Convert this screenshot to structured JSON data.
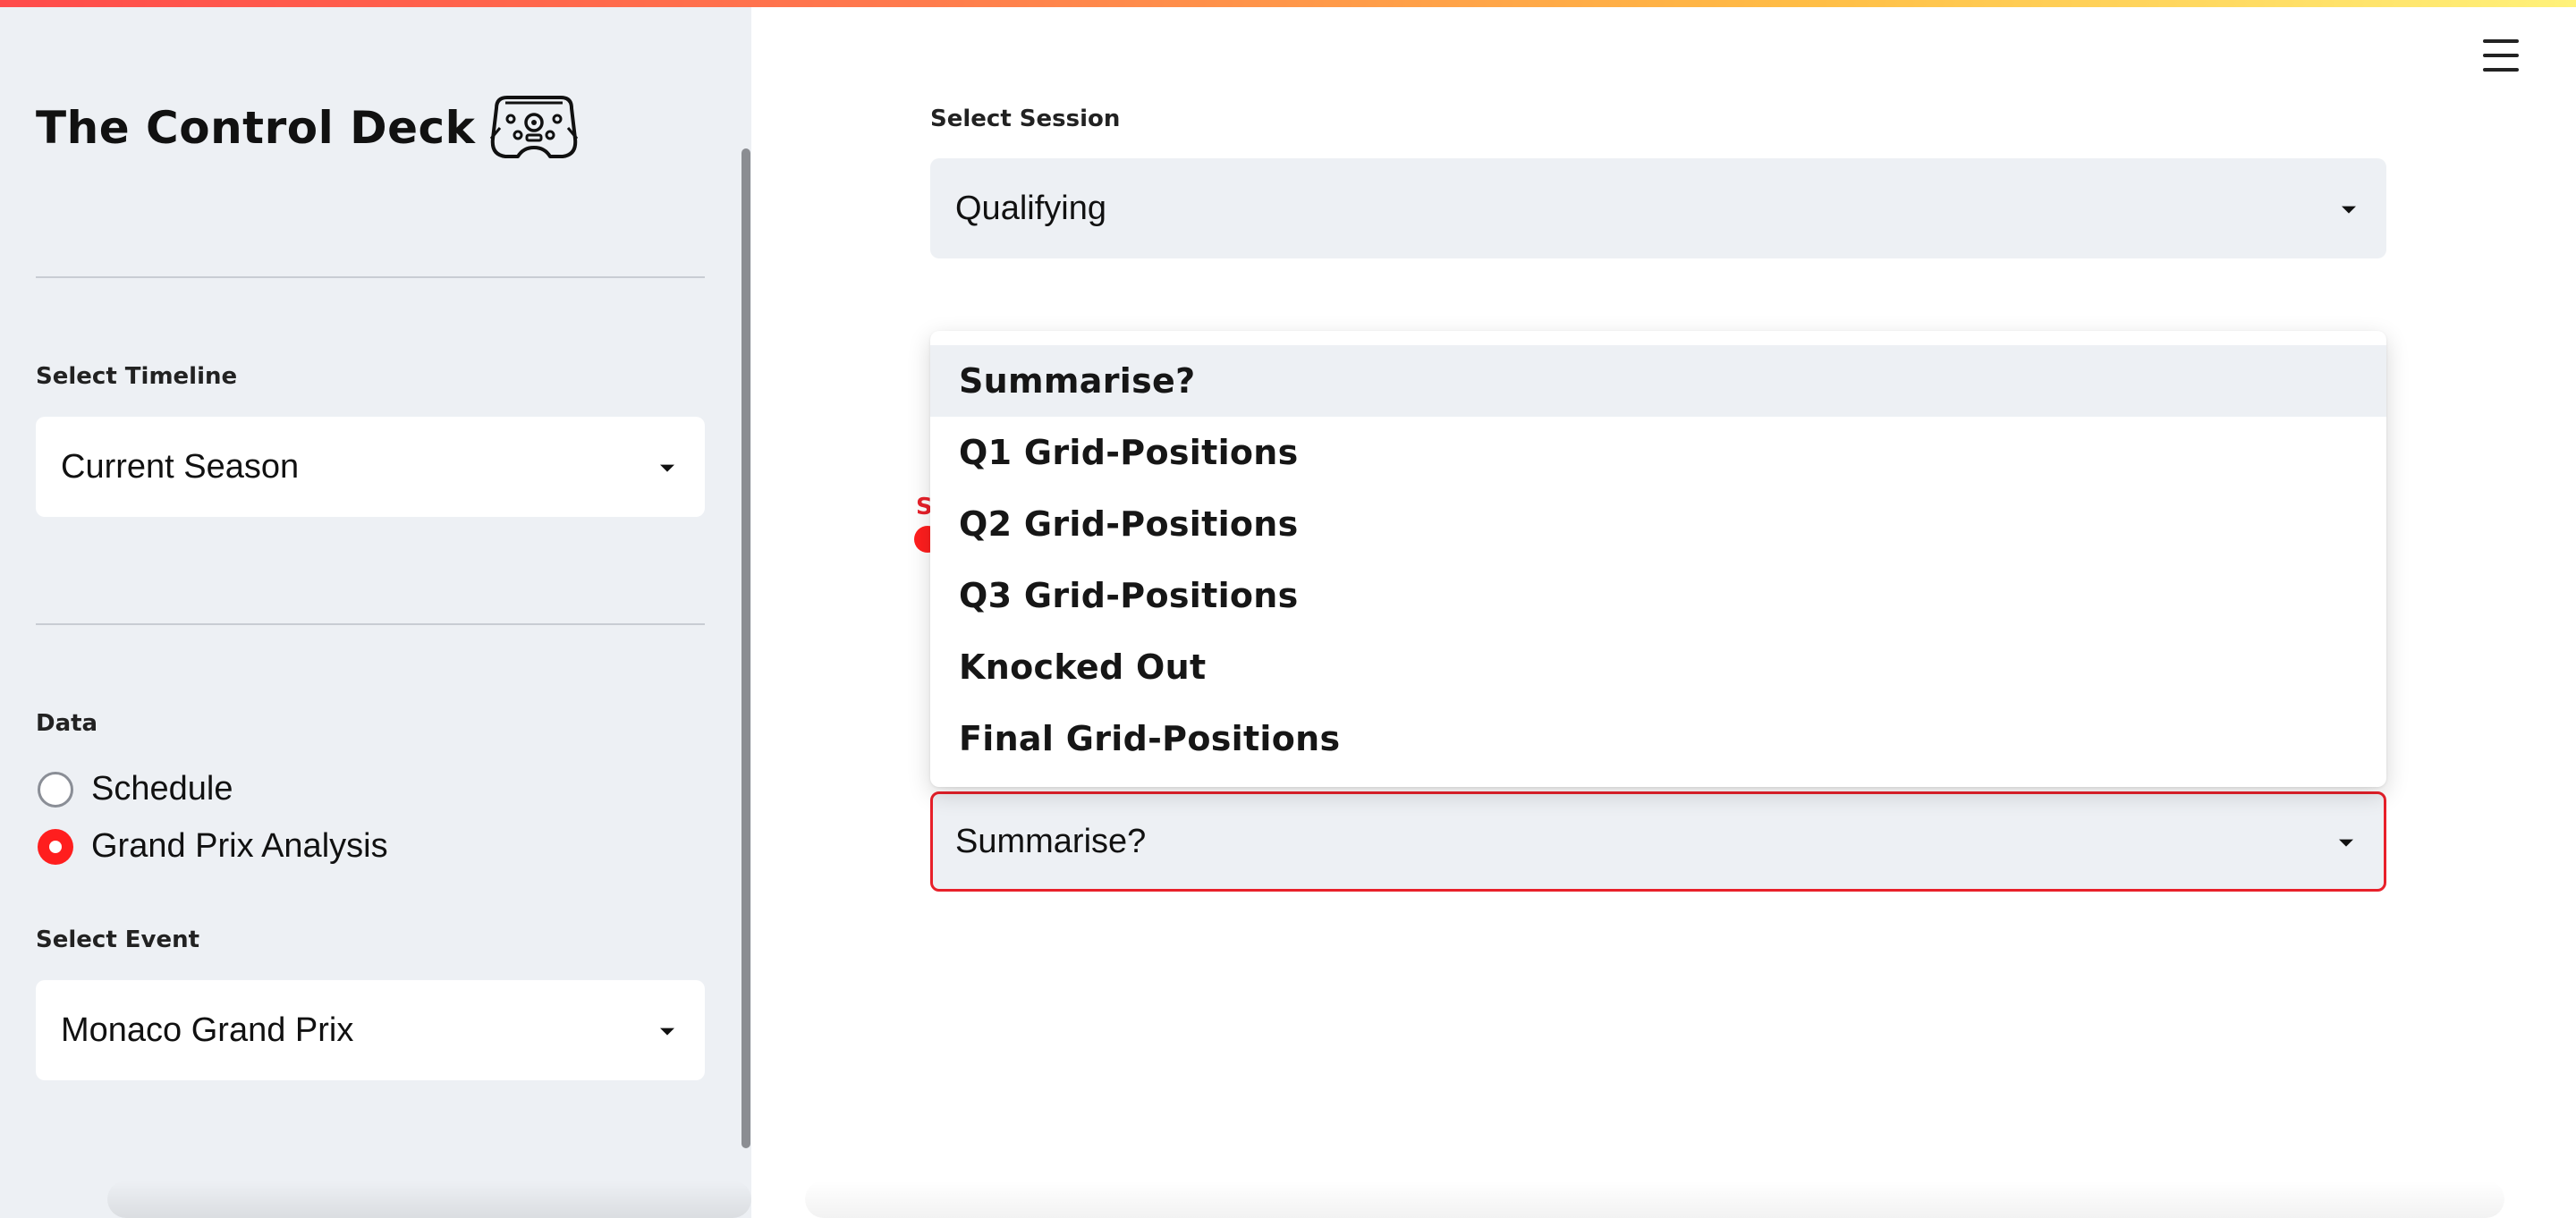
{
  "app": {
    "accent_color": "#ff1e1e",
    "sidebar_bg": "#edf0f4"
  },
  "sidebar": {
    "brand_title": "The Control Deck",
    "brand_icon": "steering-wheel-icon",
    "timeline": {
      "label": "Select Timeline",
      "value": "Current Season"
    },
    "data": {
      "label": "Data",
      "options": [
        {
          "label": "Schedule",
          "selected": false
        },
        {
          "label": "Grand Prix Analysis",
          "selected": true
        }
      ]
    },
    "event": {
      "label": "Select Event",
      "value": "Monaco Grand Prix"
    }
  },
  "main": {
    "menu_icon": "hamburger-menu-icon",
    "session": {
      "label": "Select Session",
      "value": "Qualifying"
    },
    "hidden_label_fragment": "S",
    "summary_select": {
      "value": "Summarise?",
      "focus_color": "#e8202a"
    },
    "dropdown": {
      "highlighted_index": 0,
      "options": [
        "Summarise?",
        "Q1 Grid-Positions",
        "Q2 Grid-Positions",
        "Q3 Grid-Positions",
        "Knocked Out",
        "Final Grid-Positions"
      ]
    }
  }
}
